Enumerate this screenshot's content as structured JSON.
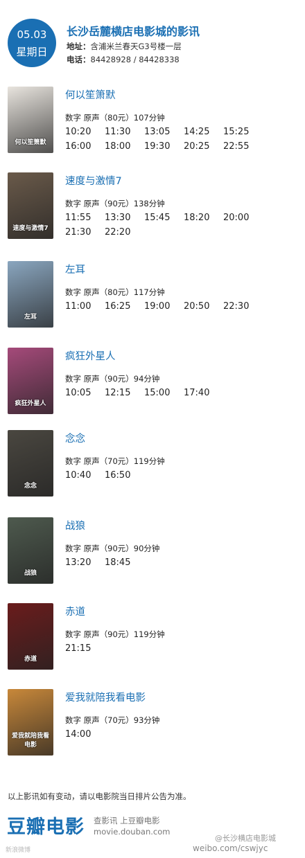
{
  "header": {
    "date": "05.03",
    "weekday": "星期日",
    "cinema_name": "长沙岳麓横店电影城的影讯",
    "address_label": "地址：",
    "address": "含浦米兰春天G3号楼一层",
    "phone_label": "电话：",
    "phone": "84428928 / 84428338"
  },
  "films": [
    {
      "title": "何以笙箫默",
      "meta": "数字  原声（80元）107分钟",
      "times": [
        "10:20",
        "11:30",
        "13:05",
        "14:25",
        "15:25",
        "16:00",
        "18:00",
        "19:30",
        "20:25",
        "22:55"
      ],
      "poster_text": "何以笙箫默",
      "poster_color": "#e8e4de"
    },
    {
      "title": "速度与激情7",
      "meta": "数字  原声（90元）138分钟",
      "times": [
        "11:55",
        "13:30",
        "15:45",
        "18:20",
        "20:00",
        "21:30",
        "22:20"
      ],
      "poster_text": "速度与激情7",
      "poster_color": "#6a5a4a"
    },
    {
      "title": "左耳",
      "meta": "数字  原声（80元）117分钟",
      "times": [
        "11:00",
        "16:25",
        "19:00",
        "20:50",
        "22:30"
      ],
      "poster_text": "左耳",
      "poster_color": "#8aa6bf"
    },
    {
      "title": "疯狂外星人",
      "meta": "数字  原声（90元）94分钟",
      "times": [
        "10:05",
        "12:15",
        "15:00",
        "17:40"
      ],
      "poster_text": "疯狂外星人",
      "poster_color": "#a54a7a"
    },
    {
      "title": "念念",
      "meta": "数字  原声（70元）119分钟",
      "times": [
        "10:40",
        "16:50"
      ],
      "poster_text": "念念",
      "poster_color": "#4a4740"
    },
    {
      "title": "战狼",
      "meta": "数字  原声（90元）90分钟",
      "times": [
        "13:20",
        "18:45"
      ],
      "poster_text": "战狼",
      "poster_color": "#4e5a4e"
    },
    {
      "title": "赤道",
      "meta": "数字  原声（90元）119分钟",
      "times": [
        "21:15"
      ],
      "poster_text": "赤道",
      "poster_color": "#6a1c1c"
    },
    {
      "title": "爱我就陪我看电影",
      "meta": "数字  原声（70元）93分钟",
      "times": [
        "14:00"
      ],
      "poster_text": "爱我就陪我看电影",
      "poster_color": "#c8883a"
    }
  ],
  "footer": {
    "notice": "以上影讯如有变动，请以电影院当日排片公告为准。",
    "logo": "豆瓣电影",
    "slogan": "查影讯 上豆瓣电影",
    "url": "movie.douban.com",
    "weibo_handle": "@长沙横店电影城",
    "weibo_url": "weibo.com/cswjyc",
    "watermark": "新浪微博"
  }
}
